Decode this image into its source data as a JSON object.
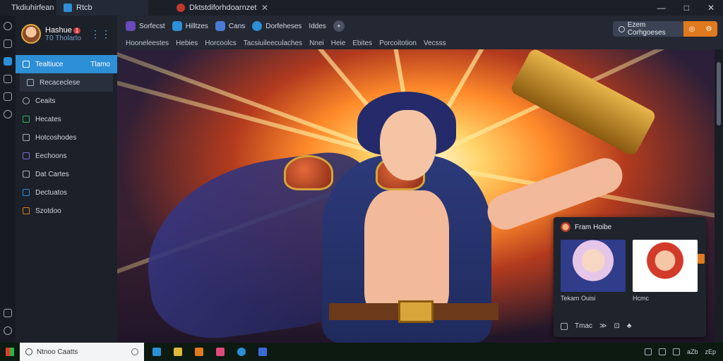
{
  "titlebar": {
    "tabs": [
      {
        "label": "Tkdiuhirfean"
      },
      {
        "label": "Rtcb"
      },
      {
        "label": "Dktstdiforhdoarnzet"
      }
    ],
    "close_glyph": "✕",
    "window_controls": [
      "—",
      "□",
      "✕"
    ]
  },
  "profile": {
    "name": "Hashue",
    "badge": "1",
    "subtitle": "T0 Tholarto",
    "more": "⋮⋮"
  },
  "sidebar": {
    "items": [
      {
        "label": "Tealtiuce",
        "right": "Tlamo",
        "icon": "home-icon",
        "active": true
      },
      {
        "label": "Recaceclese",
        "icon": "folder-icon",
        "sub": true
      },
      {
        "label": "Ceaits",
        "icon": "search-icon"
      },
      {
        "label": "Hecates",
        "icon": "chat-icon"
      },
      {
        "label": "Hotcoshodes",
        "icon": "grid-icon"
      },
      {
        "label": "Eechoons",
        "icon": "image-icon"
      },
      {
        "label": "Dat Cartes",
        "icon": "download-icon"
      },
      {
        "label": "Dectuatos",
        "icon": "play-icon"
      },
      {
        "label": "Szotdoo",
        "icon": "settings-icon"
      }
    ]
  },
  "toolbar": {
    "buttons": [
      {
        "label": "Sorfecst",
        "icon": "gallery-icon"
      },
      {
        "label": "Hilltzes",
        "icon": "brush-icon"
      },
      {
        "label": "Cans",
        "icon": "link-icon"
      },
      {
        "label": "Dorfeheses",
        "icon": "circle-icon"
      },
      {
        "label": "Iddes",
        "icon": "text-icon"
      }
    ],
    "round_button": "+",
    "search_label": "Ezem Corhgoeses",
    "orange_icons": [
      "◎",
      "⚙"
    ],
    "menu": [
      "Hooneleestes",
      "Hebies",
      "Horcoolcs",
      "Tacsiuileeculaches",
      "Nnei",
      "Heie",
      "Ebites",
      "Porcoitotion",
      "Vecsss"
    ]
  },
  "popup": {
    "title": "Fram Hoibe",
    "cards": [
      {
        "caption": "Tekam Ouisi"
      },
      {
        "caption": "Hcmc"
      }
    ],
    "footer": [
      "Tmac",
      "≫",
      "⊡",
      "♣"
    ]
  },
  "taskbar": {
    "search_placeholder": "Ntnoo Caatts",
    "apps": [
      "#2d8fd6",
      "#e0b83a",
      "#e07a1f",
      "#e04a7a",
      "#2d8fd6",
      "#3a6ad6"
    ],
    "tray_icons": [
      "wifi-icon",
      "battery-icon",
      "volume-icon"
    ],
    "tray_text": [
      "aZb",
      "zEp"
    ]
  }
}
